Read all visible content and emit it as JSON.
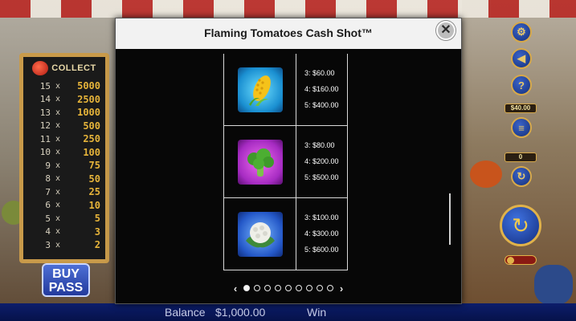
{
  "modal": {
    "title": "Flaming Tomatoes Cash Shot™",
    "close_icon": "close-icon",
    "rows": [
      {
        "symbol": "corn",
        "icon": "corn-icon",
        "payouts": [
          {
            "k": "3:",
            "v": "$60.00"
          },
          {
            "k": "4:",
            "v": "$160.00"
          },
          {
            "k": "5:",
            "v": "$400.00"
          }
        ]
      },
      {
        "symbol": "broccoli",
        "icon": "broccoli-icon",
        "payouts": [
          {
            "k": "3:",
            "v": "$80.00"
          },
          {
            "k": "4:",
            "v": "$200.00"
          },
          {
            "k": "5:",
            "v": "$500.00"
          }
        ]
      },
      {
        "symbol": "cauliflower",
        "icon": "cauliflower-icon",
        "payouts": [
          {
            "k": "3:",
            "v": "$100.00"
          },
          {
            "k": "4:",
            "v": "$300.00"
          },
          {
            "k": "5:",
            "v": "$600.00"
          }
        ]
      }
    ],
    "pager": {
      "prev": "‹",
      "next": "›",
      "pages": 9,
      "active_index": 0
    }
  },
  "board": {
    "header": "COLLECT",
    "rows": [
      {
        "n": "15",
        "x": "x",
        "v": "5000"
      },
      {
        "n": "14",
        "x": "x",
        "v": "2500"
      },
      {
        "n": "13",
        "x": "x",
        "v": "1000"
      },
      {
        "n": "12",
        "x": "x",
        "v": "500"
      },
      {
        "n": "11",
        "x": "x",
        "v": "250"
      },
      {
        "n": "10",
        "x": "x",
        "v": "100"
      },
      {
        "n": "9",
        "x": "x",
        "v": "75"
      },
      {
        "n": "8",
        "x": "x",
        "v": "50"
      },
      {
        "n": "7",
        "x": "x",
        "v": "25"
      },
      {
        "n": "6",
        "x": "x",
        "v": "10"
      },
      {
        "n": "5",
        "x": "x",
        "v": "5"
      },
      {
        "n": "4",
        "x": "x",
        "v": "3"
      },
      {
        "n": "3",
        "x": "x",
        "v": "2"
      }
    ]
  },
  "buy_pass": {
    "line1": "BUY",
    "line2": "PASS"
  },
  "controls": {
    "bet_value": "$40.00",
    "counter": "0"
  },
  "bottom": {
    "balance_label": "Balance",
    "balance_value": "$1,000.00",
    "win_label": "Win"
  }
}
